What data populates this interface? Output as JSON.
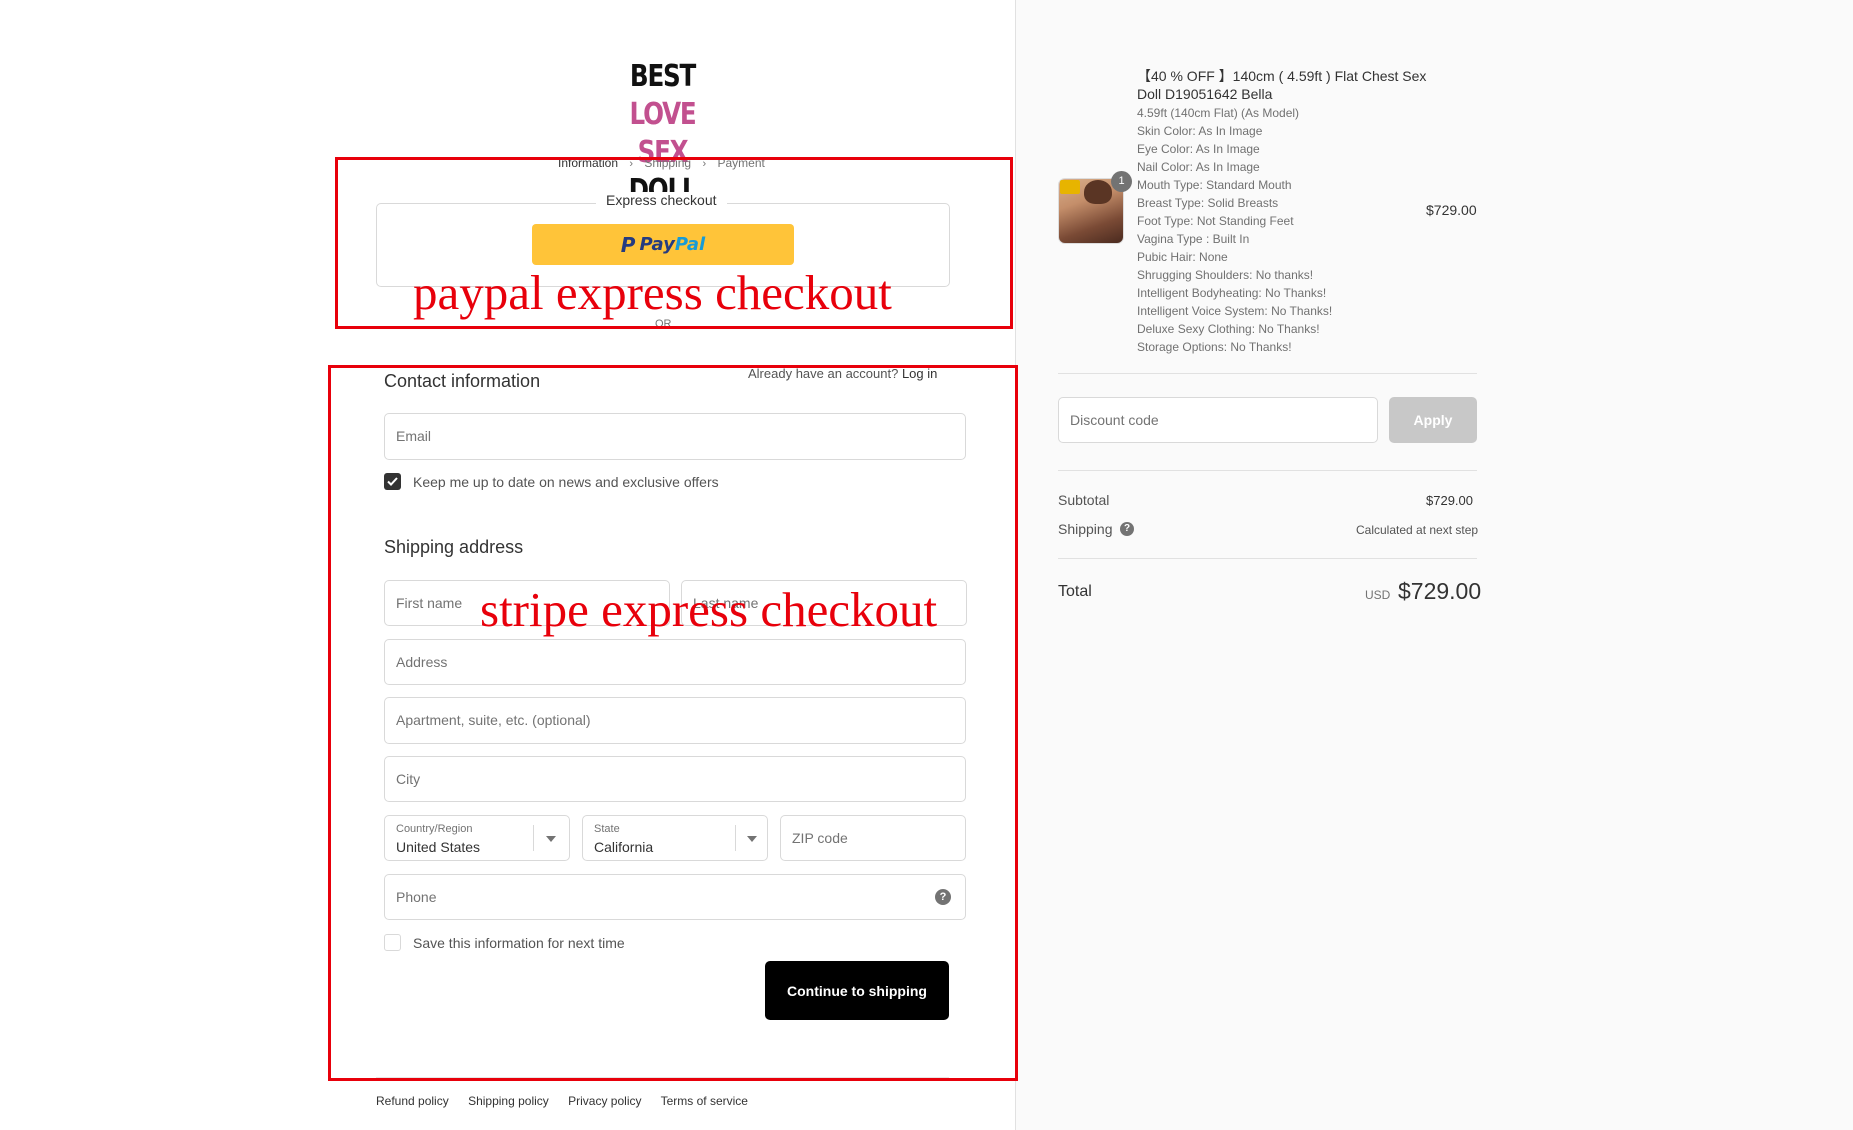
{
  "logo": {
    "line1_a": "BEST",
    "line1_b": "LOVE",
    "line2_a": "SEX",
    "line2_b": "DOLL"
  },
  "breadcrumb": {
    "step1": "Information",
    "step2": "Shipping",
    "step3": "Payment",
    "sep": "›"
  },
  "express": {
    "title": "Express checkout",
    "paypal_p": "P",
    "paypal_a": "Pay",
    "paypal_b": "Pal",
    "or": "OR"
  },
  "annotations": {
    "paypal": "paypal express checkout",
    "stripe": "stripe express checkout"
  },
  "contact": {
    "title": "Contact information",
    "account_prompt": "Already have an account?",
    "login_link": "Log in",
    "email_placeholder": "Email",
    "newsletter_label": "Keep me up to date on news and exclusive offers",
    "newsletter_checked": true
  },
  "shipping": {
    "title": "Shipping address",
    "first_name_placeholder": "First name",
    "last_name_placeholder": "Last name",
    "address_placeholder": "Address",
    "apartment_placeholder": "Apartment, suite, etc. (optional)",
    "city_placeholder": "City",
    "country_label": "Country/Region",
    "country_value": "United States",
    "state_label": "State",
    "state_value": "California",
    "zip_placeholder": "ZIP code",
    "phone_placeholder": "Phone",
    "help": "?",
    "save_label": "Save this information for next time",
    "save_checked": false,
    "continue_label": "Continue to shipping"
  },
  "footer": {
    "links": [
      "Refund policy",
      "Shipping policy",
      "Privacy policy",
      "Terms of service"
    ]
  },
  "order": {
    "quantity": "1",
    "product_title": "【40 % OFF 】140cm ( 4.59ft ) Flat Chest Sex Doll D19051642 Bella",
    "variants": [
      "4.59ft (140cm Flat) (As Model)",
      "Skin Color: As In Image",
      "Eye Color: As In Image",
      "Nail Color: As In Image",
      "Mouth Type: Standard Mouth",
      "Breast Type: Solid Breasts",
      "Foot Type: Not Standing Feet",
      "Vagina Type : Built In",
      "Pubic Hair: None",
      "Shrugging Shoulders: No thanks!",
      "Intelligent Bodyheating: No Thanks!",
      "Intelligent Voice System: No Thanks!",
      "Deluxe Sexy Clothing: No Thanks!",
      "Storage Options: No Thanks!"
    ],
    "price": "$729.00",
    "discount_placeholder": "Discount code",
    "apply_label": "Apply",
    "subtotal_label": "Subtotal",
    "subtotal_value": "$729.00",
    "shipping_label": "Shipping",
    "shipping_value": "Calculated at next step",
    "total_label": "Total",
    "currency": "USD",
    "total_value": "$729.00"
  },
  "colors": {
    "accent_pink": "#c2508f",
    "paypal_yellow": "#ffc439",
    "annotation_red": "#e8000b",
    "button_black": "#000000"
  }
}
